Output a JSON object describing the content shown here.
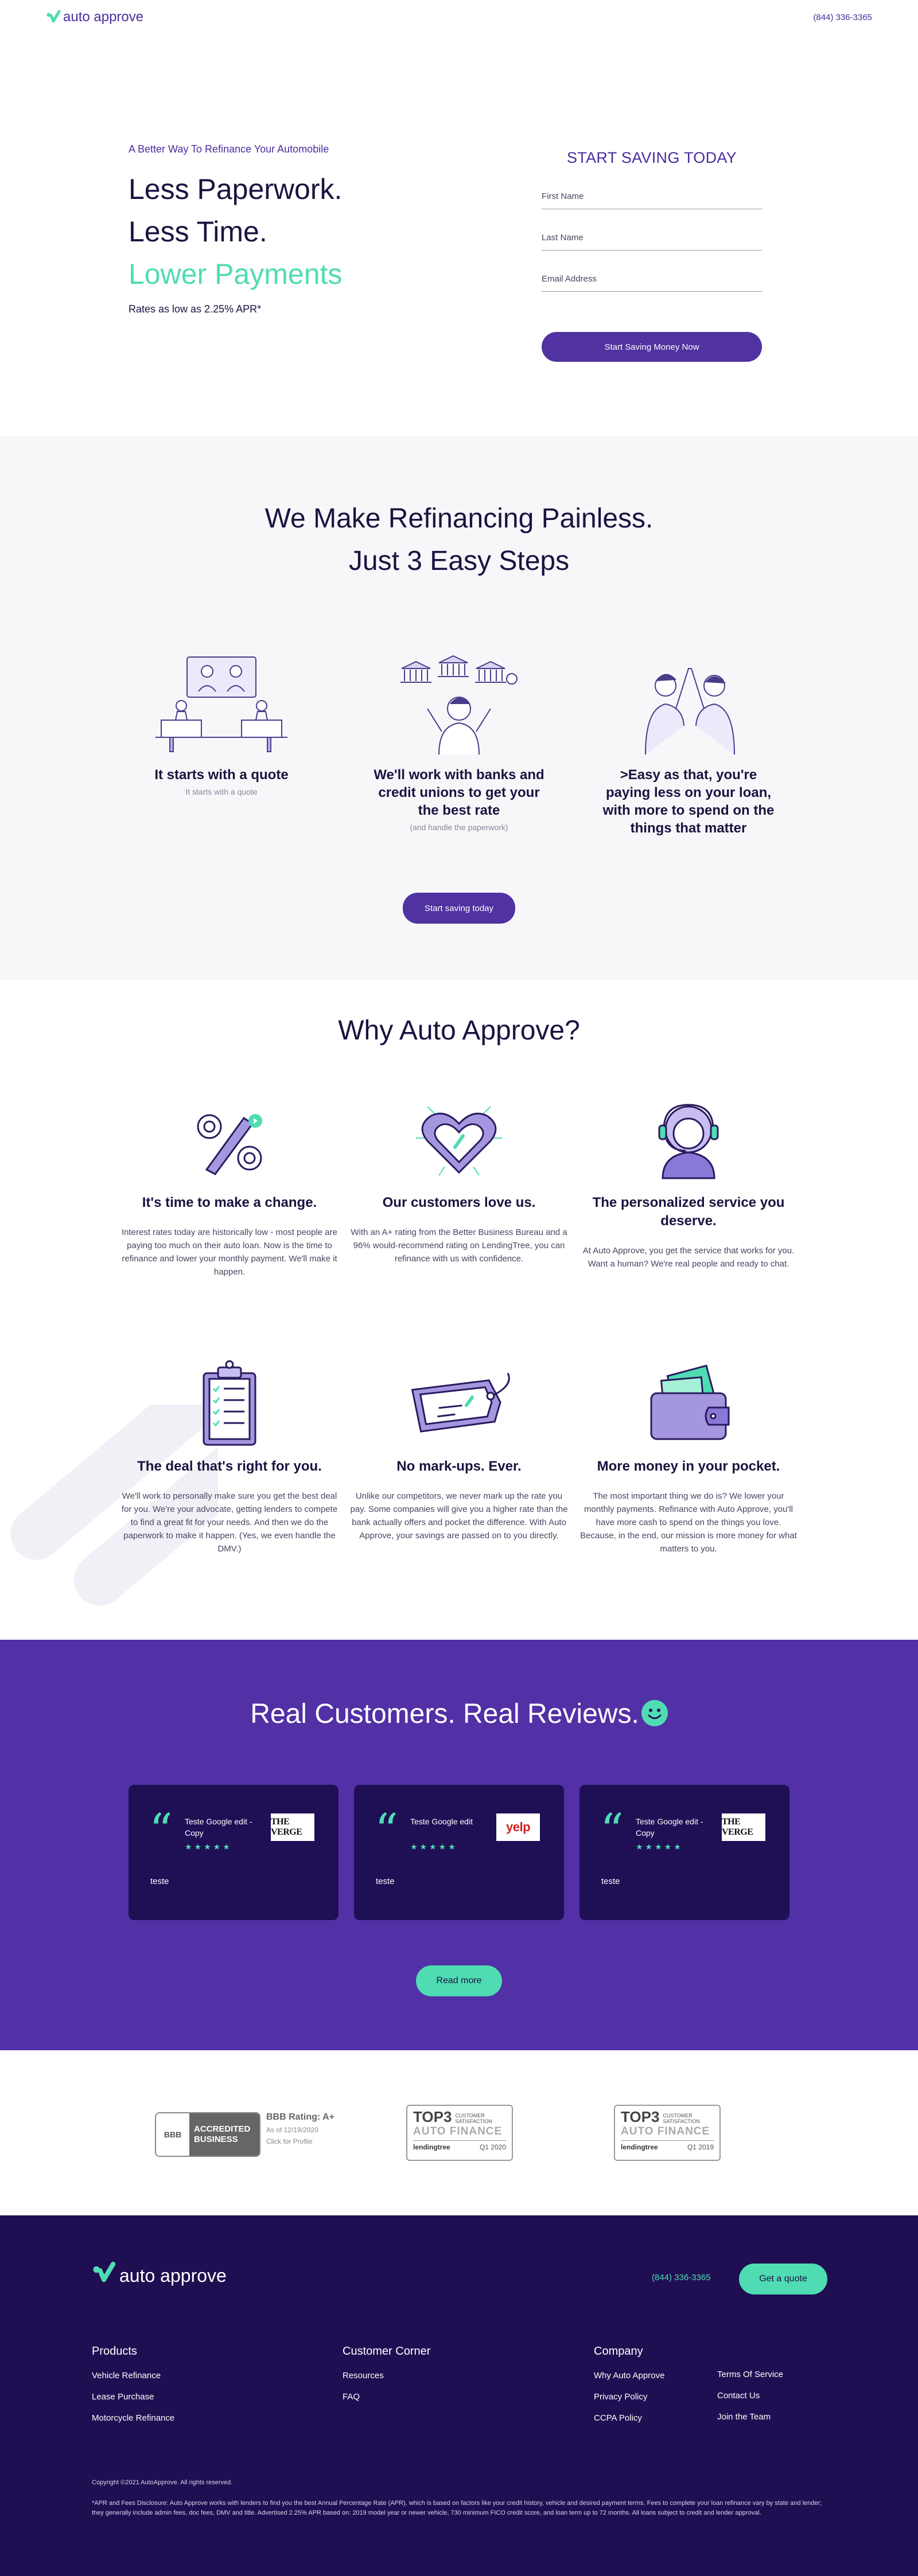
{
  "colors": {
    "primary": "#5032a0",
    "accent": "#4fdcb3",
    "dark": "#1f0f52",
    "text": "#1c1240"
  },
  "header": {
    "logo_text": "auto approve",
    "phone": "(844) 336-3365"
  },
  "hero": {
    "kicker": "A Better Way To Refinance Your Automobile",
    "line1": "Less Paperwork.",
    "line2": "Less Time.",
    "line3": "Lower Payments",
    "rates": "Rates as low as 2.25% APR*"
  },
  "form": {
    "title": "START SAVING TODAY",
    "first_name_placeholder": "First Name",
    "last_name_placeholder": "Last Name",
    "email_placeholder": "Email Address",
    "submit_label": "Start Saving Money Now"
  },
  "steps": {
    "title_line1": "We Make Refinancing Painless.",
    "title_line2": "Just 3 Easy Steps",
    "items": [
      {
        "title": "It starts with a quote",
        "sub": "It starts with a quote",
        "art": "office-desk-illustration"
      },
      {
        "title": "We'll work with banks and credit unions to get your the best rate",
        "sub": "(and handle the paperwork)",
        "art": "banks-illustration"
      },
      {
        "title": ">Easy as that, you're paying less on your loan, with more to spend on the things that matter",
        "sub": "",
        "art": "high-five-illustration"
      }
    ],
    "cta_label": "Start saving today"
  },
  "why": {
    "title": "Why Auto Approve?",
    "items": [
      {
        "title": "It's time to make a change.",
        "text": "Interest rates today are historically low - most people are paying too much on their auto loan. Now is the time to refinance and lower your monthly payment. We'll make it happen.",
        "icon": "percent-icon"
      },
      {
        "title": "Our customers love us.",
        "text": "With an A+ rating from the Better Business Bureau and a 96% would-recommend rating on LendingTree, you can refinance with us with confidence.",
        "icon": "heart-icon"
      },
      {
        "title": "The personalized service you deserve.",
        "text": "At Auto Approve, you get the service that works for you. Want a human? We're real people and ready to chat.",
        "icon": "support-agent-icon"
      },
      {
        "title": "The deal that's right for you.",
        "text": "We'll work to personally make sure you get the best deal for you. We're your advocate, getting lenders to compete to find a great fit for your needs. And then we do the paperwork to make it happen. (Yes, we even handle the DMV.)",
        "icon": "clipboard-checklist-icon"
      },
      {
        "title": "No mark-ups. Ever.",
        "text": "Unlike our competitors, we never mark up the rate you pay. Some companies will give you a higher rate than the bank actually offers and pocket the difference. With Auto Approve, your savings are passed on to you directly.",
        "icon": "price-tag-icon"
      },
      {
        "title": "More money in your pocket.",
        "text": "The most important thing we do is? We lower your monthly payments. Refinance with Auto Approve, you'll have more cash to spend on the things you love. Because, in the end, our mission is more money for what matters to you.",
        "icon": "wallet-icon"
      }
    ]
  },
  "reviews": {
    "title": "Real Customers. Real Reviews.",
    "items": [
      {
        "head": "Teste Google edit - Copy",
        "logo": "THE VERGE",
        "text": "teste"
      },
      {
        "head": "Teste Google edit",
        "logo": "yelp",
        "text": "teste"
      },
      {
        "head": "Teste Google edit - Copy",
        "logo": "THE VERGE",
        "text": "teste"
      }
    ],
    "stars": "★★★★★",
    "read_more": "Read more"
  },
  "badges": {
    "bbb_seal": "BBB",
    "bbb_accredited": "ACCREDITED BUSINESS",
    "bbb_rating": "BBB Rating: A+",
    "bbb_date": "As of 12/19/2020",
    "bbb_click": "Click for Profile",
    "top3_a": {
      "big": "TOP3",
      "small": "CUSTOMER SATISFACTION",
      "category": "AUTO FINANCE",
      "brand": "lendingtree",
      "period": "Q1 2020"
    },
    "top3_b": {
      "big": "TOP3",
      "small": "CUSTOMER SATISFACTION",
      "category": "AUTO FINANCE",
      "brand": "lendingtree",
      "period": "Q1 2019"
    }
  },
  "footer": {
    "logo_text": "auto approve",
    "phone": "(844) 336-3365",
    "quote_label": "Get a quote",
    "products": {
      "title": "Products",
      "links": [
        "Vehicle Refinance",
        "Lease Purchase",
        "Motorcycle Refinance"
      ]
    },
    "corner": {
      "title": "Customer Corner",
      "links": [
        "Resources",
        "FAQ"
      ]
    },
    "company": {
      "title": "Company",
      "links": [
        "Why Auto Approve",
        "Privacy Policy",
        "CCPA Policy"
      ],
      "links2": [
        "Terms Of Service",
        "Contact Us",
        "Join the Team"
      ]
    },
    "copyright": "Copyright ©2021 AutoApprove. All rights reserved.",
    "disclosure": "*APR and Fees Disclosure: Auto Approve works with lenders to find you the best Annual Percentage Rate (APR), which is based on factors like your credit history, vehicle and desired payment terms. Fees to complete your loan refinance vary by state and lender; they generally include admin fees, doc fees, DMV and title. Advertised 2.25% APR based on: 2019 model year or newer vehicle, 730 minimum FICO credit score, and loan term up to 72 months. All loans subject to credit and lender approval."
  }
}
